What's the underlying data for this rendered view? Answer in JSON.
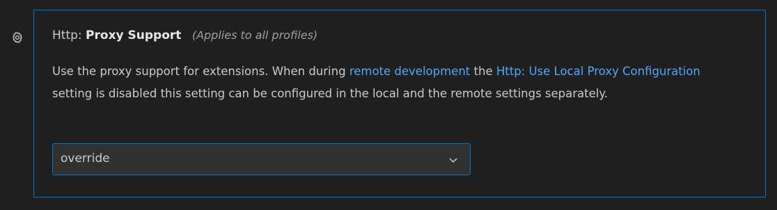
{
  "setting": {
    "category": "Http:",
    "label": "Proxy Support",
    "scope": "(Applies to all profiles)",
    "description": {
      "text1": "Use the proxy support for extensions. When during ",
      "link1": "remote development",
      "text2": " the ",
      "link2": "Http: Use Local Proxy Configuration",
      "text3": " setting is disabled this setting can be configured in the local and the remote settings separately."
    },
    "value": "override"
  },
  "icons": {
    "gear": "gear-icon",
    "chevron": "chevron-down-icon"
  },
  "colors": {
    "accent": "#0078d4",
    "link": "#4daafc",
    "background": "#1f1f1f",
    "dropdown_bg": "#313131"
  }
}
